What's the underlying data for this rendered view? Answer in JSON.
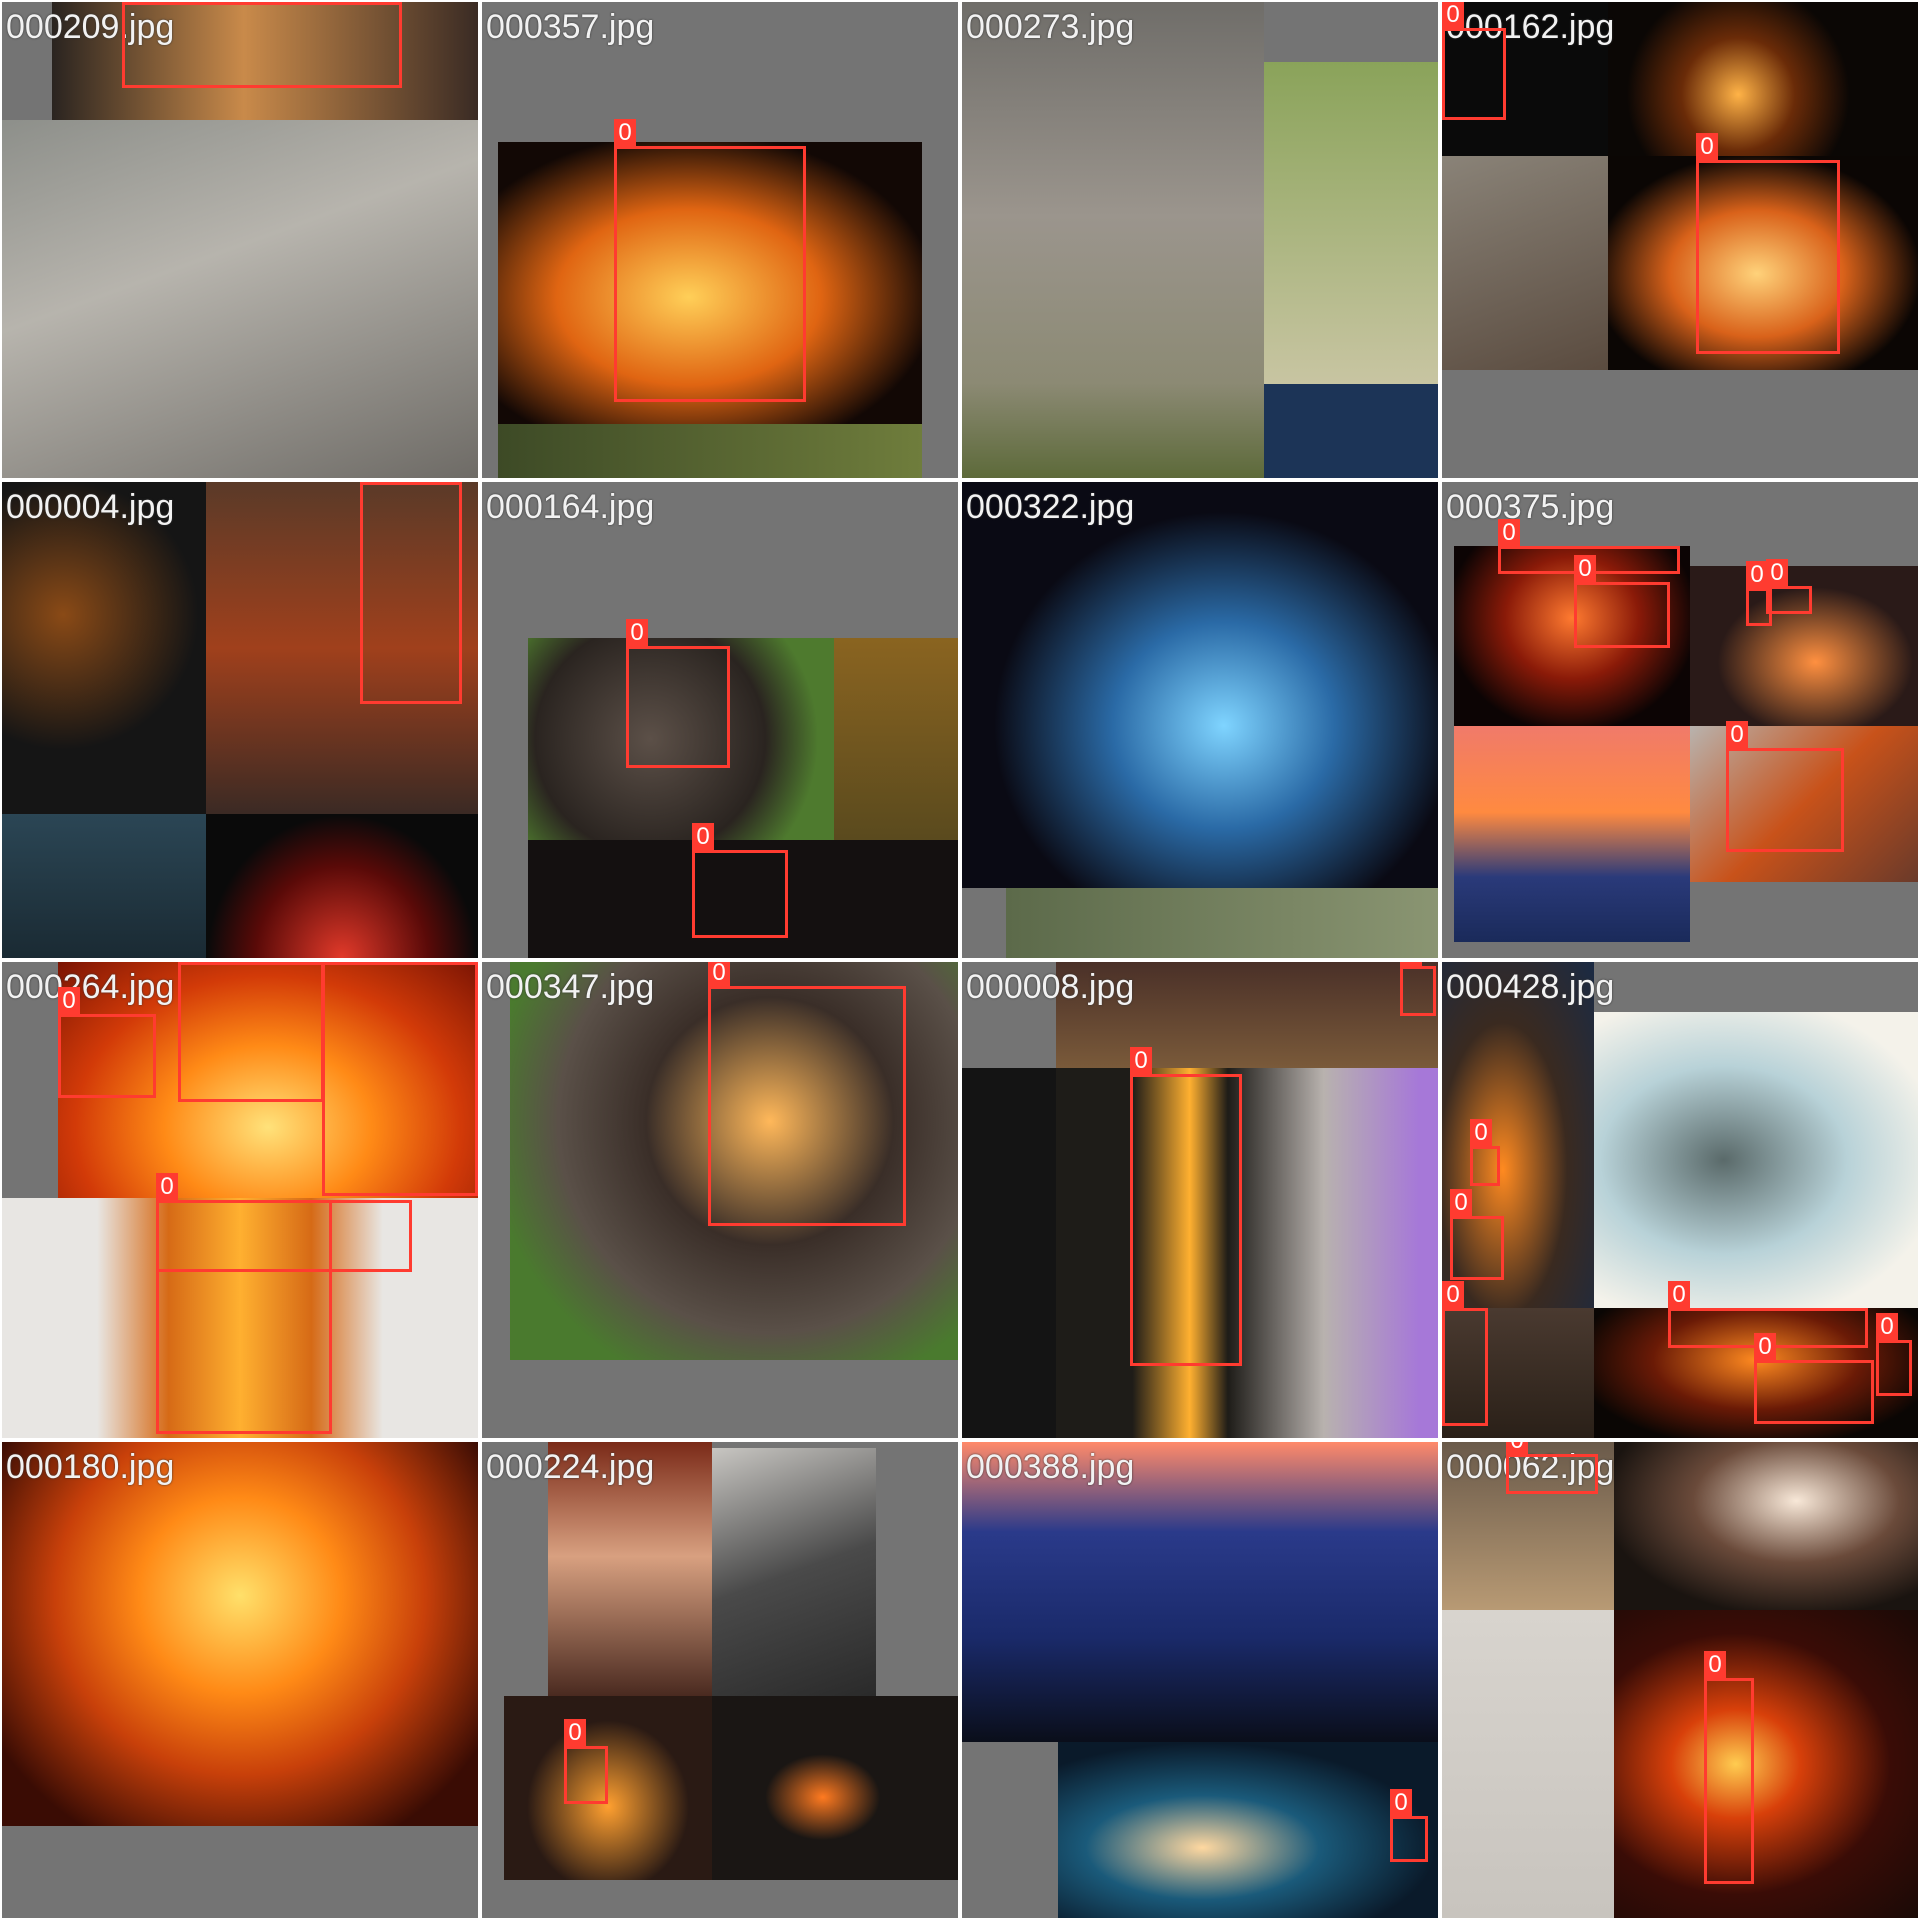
{
  "grid": {
    "tiles": [
      {
        "filename": "000209.jpg"
      },
      {
        "filename": "000357.jpg"
      },
      {
        "filename": "000273.jpg"
      },
      {
        "filename": "000162.jpg"
      },
      {
        "filename": "000004.jpg"
      },
      {
        "filename": "000164.jpg"
      },
      {
        "filename": "000322.jpg"
      },
      {
        "filename": "000375.jpg"
      },
      {
        "filename": "000264.jpg"
      },
      {
        "filename": "000347.jpg"
      },
      {
        "filename": "000008.jpg"
      },
      {
        "filename": "000428.jpg"
      },
      {
        "filename": "000180.jpg"
      },
      {
        "filename": "000224.jpg"
      },
      {
        "filename": "000388.jpg"
      },
      {
        "filename": "000062.jpg"
      }
    ]
  },
  "detection": {
    "class_label": "0",
    "box_color": "#ff3b30"
  }
}
